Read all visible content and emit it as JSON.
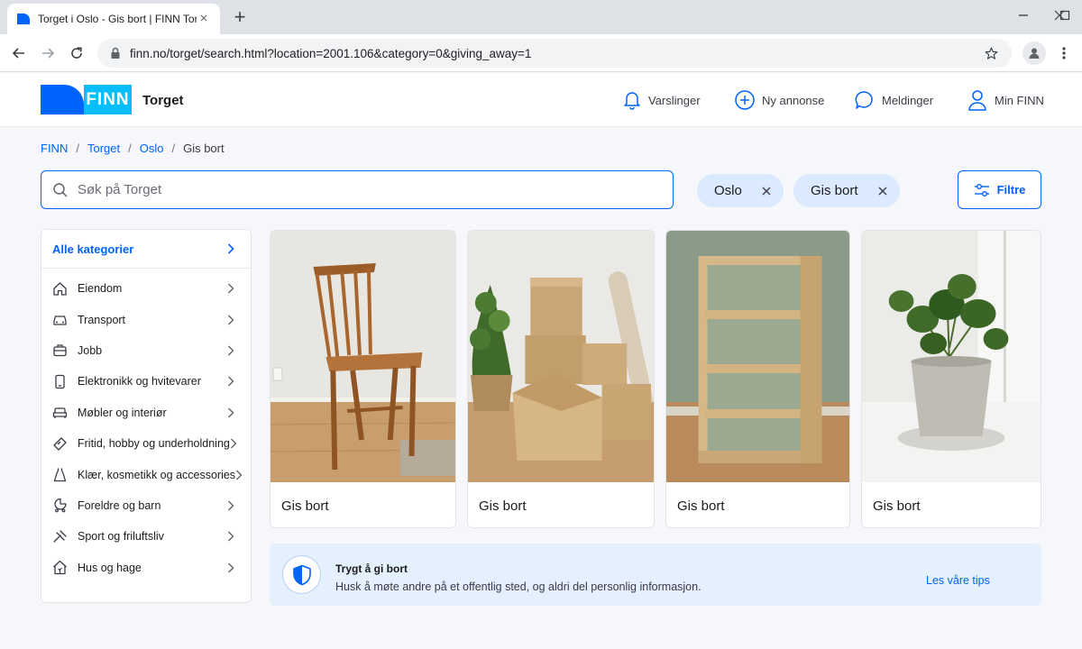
{
  "browser": {
    "tab_title": "Torget i Oslo - Gis bort | FINN Torget",
    "url": "finn.no/torget/search.html?location=2001.106&category=0&giving_away=1"
  },
  "header": {
    "logo_text": "FINN",
    "site_name": "Torget",
    "nav": {
      "notifications": "Varslinger",
      "new_ad": "Ny annonse",
      "messages": "Meldinger",
      "my_finn": "Min FINN"
    }
  },
  "breadcrumb": [
    "FINN",
    "Torget",
    "Oslo",
    "Gis bort"
  ],
  "search": {
    "placeholder": "Søk på Torget"
  },
  "filters": {
    "chips": [
      "Oslo",
      "Gis bort"
    ],
    "button_label": "Filtre"
  },
  "sidebar": {
    "all_categories": "Alle kategorier",
    "items": [
      {
        "label": "Eiendom",
        "icon": "house-icon"
      },
      {
        "label": "Transport",
        "icon": "car-icon"
      },
      {
        "label": "Jobb",
        "icon": "briefcase-icon"
      },
      {
        "label": "Elektronikk og hvitevarer",
        "icon": "phone-icon"
      },
      {
        "label": "Møbler og interiør",
        "icon": "sofa-icon"
      },
      {
        "label": "Fritid, hobby og underholdning",
        "icon": "ticket-icon"
      },
      {
        "label": "Klær, kosmetikk og accessories",
        "icon": "dress-icon"
      },
      {
        "label": "Foreldre og barn",
        "icon": "stroller-icon"
      },
      {
        "label": "Sport og friluftsliv",
        "icon": "sport-icon"
      },
      {
        "label": "Hus og hage",
        "icon": "home-garden-icon"
      }
    ]
  },
  "listings": [
    {
      "title": "Gis bort",
      "image": "wooden chair"
    },
    {
      "title": "Gis bort",
      "image": "moving boxes"
    },
    {
      "title": "Gis bort",
      "image": "bookshelf"
    },
    {
      "title": "Gis bort",
      "image": "potted plant"
    }
  ],
  "banner": {
    "title": "Trygt å gi bort",
    "text": "Husk å møte andre på et offentlig sted, og aldri del personlig informasjon.",
    "link": "Les våre tips"
  },
  "colors": {
    "accent": "#0063fb",
    "logo_blue": "#0063fb",
    "logo_light": "#06befb",
    "chip_bg": "#dceaff",
    "banner_bg": "#e5f0fd"
  }
}
